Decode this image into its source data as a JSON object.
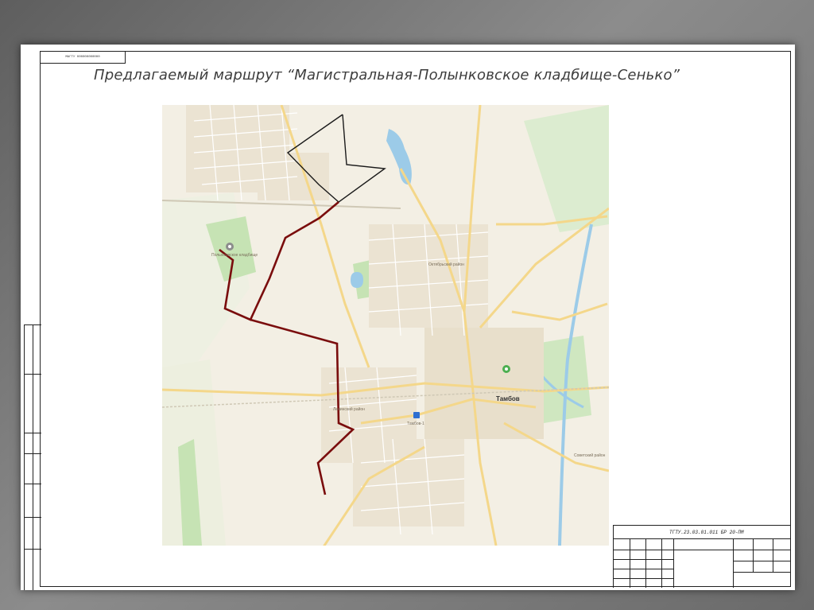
{
  "sheet": {
    "stamp_text": "МАГТУ 000000000000",
    "title": "Предлагаемый маршрут “Магистральная-Полынковское кладбище-Сенько”",
    "title_block_code": "ТГТУ.23.03.01.011 БР 20-ПМ"
  },
  "map": {
    "city_label": "Тамбов",
    "cemetery_label": "Полынковское кладбище",
    "station_label": "Тамбов-1",
    "district_label_1": "Октябрьский район",
    "district_label_2": "Ленинский район",
    "district_label_3": "Советский район",
    "colors": {
      "background": "#f3efe4",
      "road": "#f4d78a",
      "street": "#ffffff",
      "park": "#c6e3b4",
      "water": "#9ccbe8",
      "route": "#7a0d0d",
      "route_north_loop": "#1a1a1a"
    }
  },
  "icons": {
    "cemetery_marker": "map-pin-icon",
    "station_marker": "train-icon",
    "city_marker": "pin-icon"
  }
}
